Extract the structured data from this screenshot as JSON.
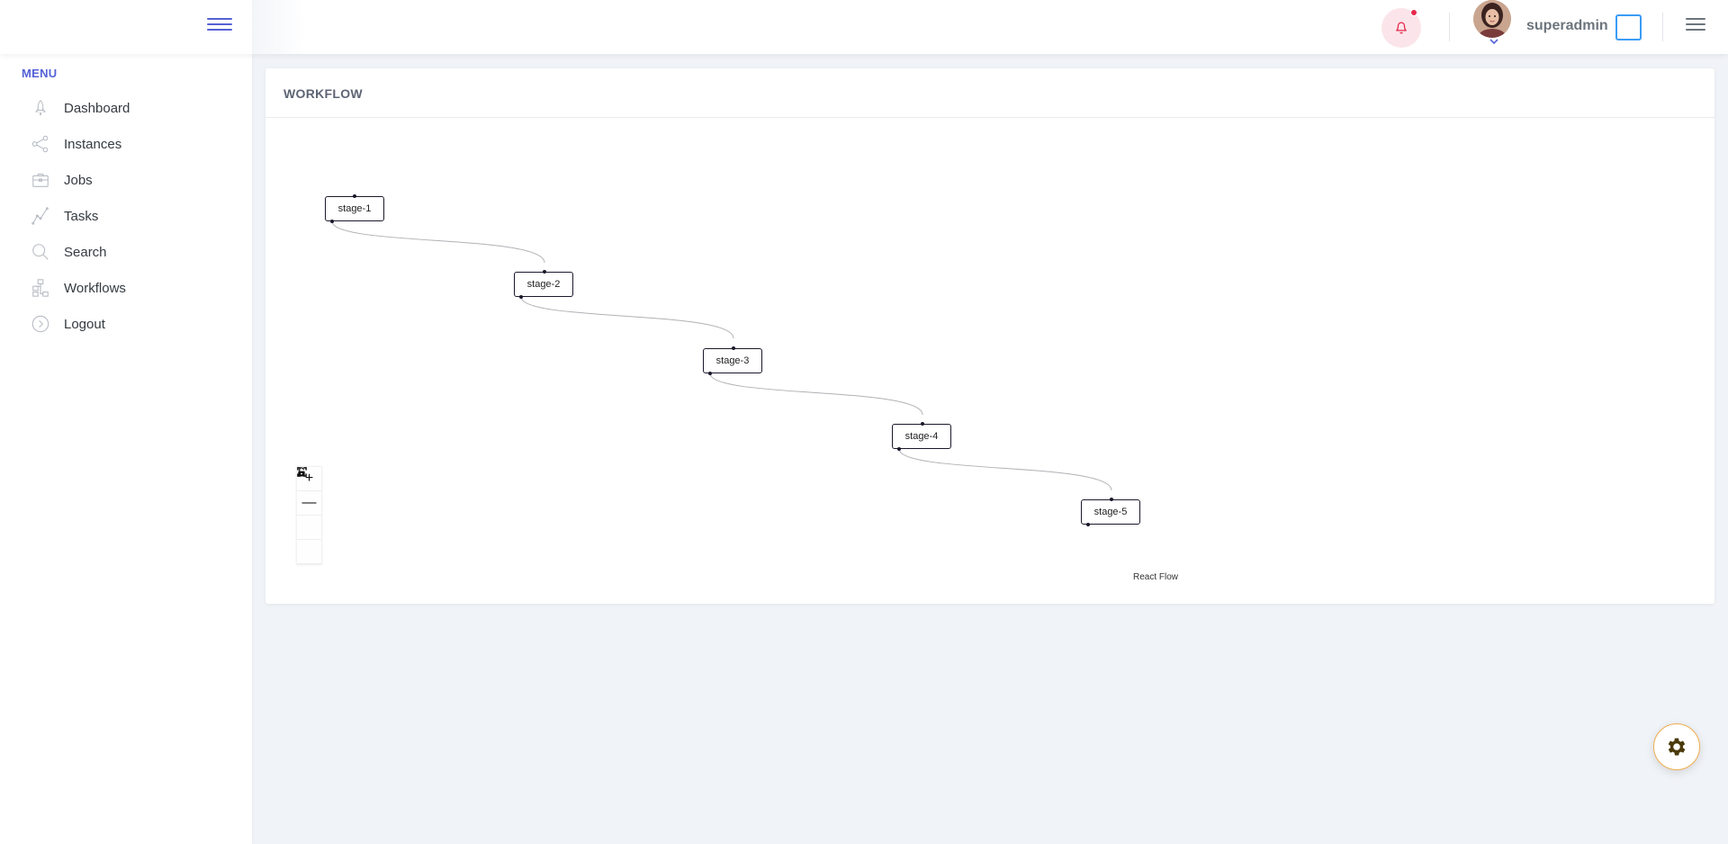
{
  "header": {
    "username": "superadmin"
  },
  "sidebar": {
    "menu_title": "MENU",
    "items": [
      {
        "label": "Dashboard",
        "icon": "rocket-icon"
      },
      {
        "label": "Instances",
        "icon": "share-icon"
      },
      {
        "label": "Jobs",
        "icon": "briefcase-icon"
      },
      {
        "label": "Tasks",
        "icon": "line-chart-icon"
      },
      {
        "label": "Search",
        "icon": "search-icon"
      },
      {
        "label": "Workflows",
        "icon": "hierarchy-icon"
      },
      {
        "label": "Logout",
        "icon": "arrow-circle-icon"
      }
    ]
  },
  "card": {
    "title": "WORKFLOW"
  },
  "flow": {
    "nodes": [
      {
        "id": "stage-1",
        "label": "stage-1"
      },
      {
        "id": "stage-2",
        "label": "stage-2"
      },
      {
        "id": "stage-3",
        "label": "stage-3"
      },
      {
        "id": "stage-4",
        "label": "stage-4"
      },
      {
        "id": "stage-5",
        "label": "stage-5"
      }
    ],
    "controls": {
      "zoom_in": "+",
      "zoom_out": "—"
    },
    "attribution": "React Flow"
  },
  "colors": {
    "accent": "#5561d6",
    "notification": "#e6294b",
    "settings_border": "#f0ad4e"
  }
}
